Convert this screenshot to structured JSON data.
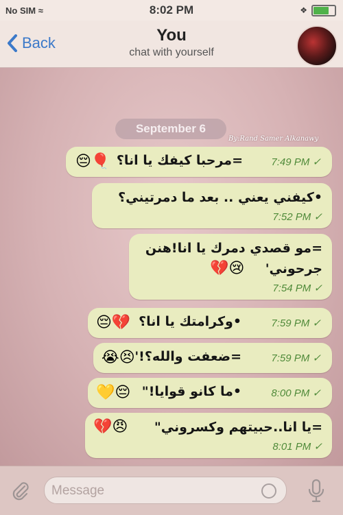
{
  "status_bar": {
    "carrier": "No SIM",
    "time": "8:02 PM",
    "battery_percent": 75,
    "battery_color": "#4fb24a"
  },
  "nav": {
    "back_label": "Back",
    "title": "You",
    "subtitle": "chat with yourself",
    "back_color": "#3b79c9"
  },
  "chat": {
    "date": "September 6",
    "watermark": "By:Rand Samer Alkanawy",
    "bubble_color": "#e9ecc0",
    "time_color": "#4f8a39",
    "messages": [
      {
        "text": "=مرحبا كيفك يا انا؟",
        "emoji": "😔🎈",
        "time": "7:49 PM ✓"
      },
      {
        "text": "•كيفني يعني .. بعد ما دمرتيني؟",
        "time": "7:52 PM ✓"
      },
      {
        "text": "=مو قصدي دمرك يا انا!هنن",
        "text2": "جرحوني'",
        "emoji": "💔😢",
        "time": "7:54 PM ✓"
      },
      {
        "text": "•وكرامتك يا انا؟",
        "emoji": "😔💔",
        "time": "7:59 PM ✓"
      },
      {
        "text": "=ضعفت والله؟!'",
        "emoji": "😭😣",
        "time": "7:59 PM ✓"
      },
      {
        "text": "•ما كانو قوايا!\"",
        "emoji": "💛😔",
        "time": "8:00 PM ✓"
      },
      {
        "text": "=يا انا..حبيتهم وكسروني\"",
        "emoji": "💔😠",
        "time": "8:01 PM ✓"
      }
    ]
  },
  "input": {
    "placeholder": "Message"
  },
  "icons": {
    "back": "chevron-left-icon",
    "attach": "paperclip-icon",
    "sticker": "sticker-icon",
    "mic": "microphone-icon",
    "wifi": "wifi-icon",
    "battery": "battery-icon"
  }
}
